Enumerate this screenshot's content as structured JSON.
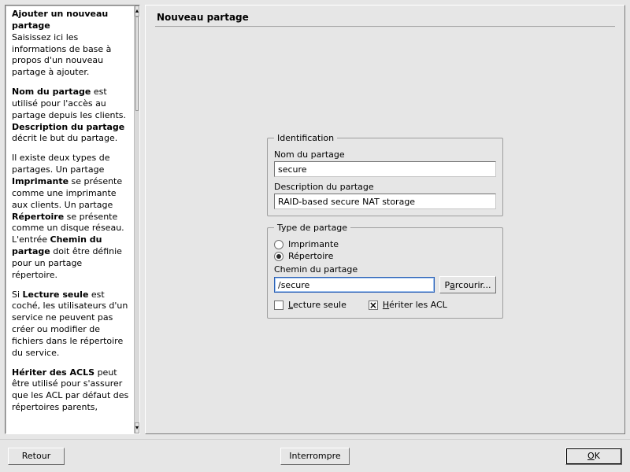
{
  "help": {
    "title": "Ajouter un nouveau partage",
    "p1": "Saisissez ici les informations de base à propos d'un nouveau partage à ajouter.",
    "p2a": "Nom du partage",
    "p2b": " est utilisé pour l'accès au partage depuis les clients. ",
    "p2c": "Description du partage",
    "p2d": " décrit le but du partage.",
    "p3a": "Il existe deux types de partages. Un partage ",
    "p3b": "Imprimante",
    "p3c": " se présente comme une imprimante aux clients. Un partage ",
    "p3d": "Répertoire",
    "p3e": " se présente comme un disque réseau. L'entrée ",
    "p3f": "Chemin du partage",
    "p3g": " doit être définie pour un partage répertoire.",
    "p4a": "Si ",
    "p4b": "Lecture seule",
    "p4c": " est coché, les utilisateurs d'un service ne peuvent pas créer ou modifier de fichiers dans le répertoire du service.",
    "p5a": "Hériter des ACLS",
    "p5b": " peut être utilisé pour s'assurer que les ACL par défaut des répertoires parents,"
  },
  "main": {
    "title": "Nouveau partage",
    "identification": {
      "legend": "Identification",
      "name_label": "Nom du partage",
      "name_value": "secure",
      "desc_label": "Description du partage",
      "desc_value": "RAID-based secure NAT storage"
    },
    "share_type": {
      "legend": "Type de partage",
      "printer_label": "Imprimante",
      "directory_label": "Répertoire",
      "selected": "directory",
      "path_label": "Chemin du partage",
      "path_value": "/secure",
      "browse_label_pre": "P",
      "browse_label_u": "a",
      "browse_label_post": "rcourir...",
      "readonly_label_u": "L",
      "readonly_label_post": "ecture seule",
      "readonly_checked": false,
      "inherit_label_u": "H",
      "inherit_label_post": "ériter les ACL",
      "inherit_checked": true
    }
  },
  "buttons": {
    "back": "Retour",
    "abort": "Interrompre",
    "ok_u": "O",
    "ok_post": "K"
  }
}
